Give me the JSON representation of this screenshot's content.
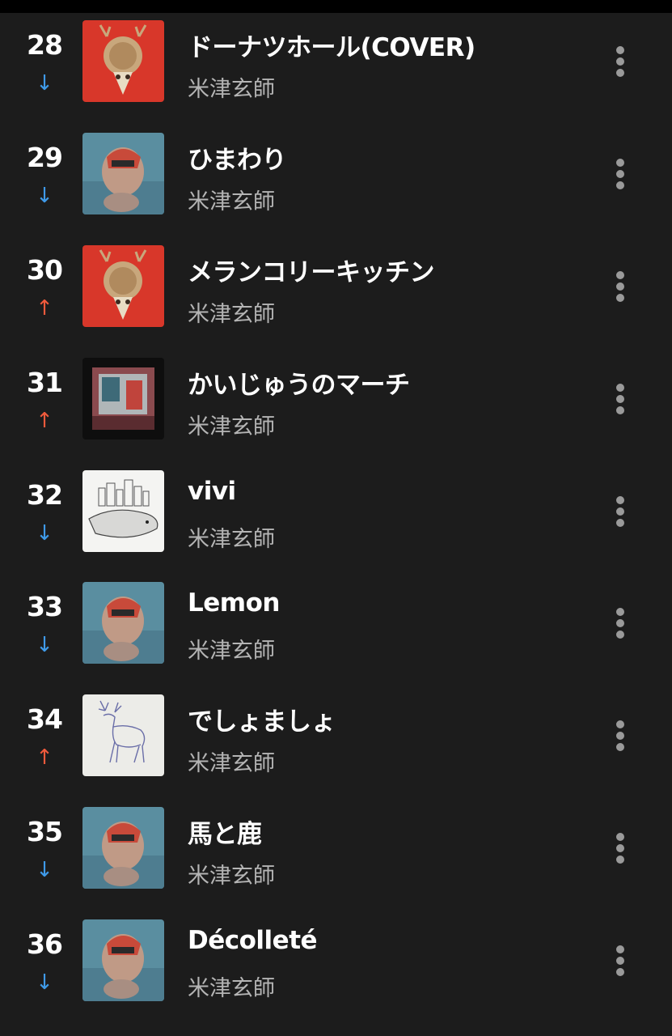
{
  "chart": {
    "rows": [
      {
        "rank": "28",
        "trend": "down",
        "trend_icon": "↓",
        "title": "ドーナツホール(COVER)",
        "artist": "米津玄師",
        "art": "yankee"
      },
      {
        "rank": "29",
        "trend": "down",
        "trend_icon": "↓",
        "title": "ひまわり",
        "artist": "米津玄師",
        "art": "stray-sheep"
      },
      {
        "rank": "30",
        "trend": "up",
        "trend_icon": "↑",
        "title": "メランコリーキッチン",
        "artist": "米津玄師",
        "art": "yankee"
      },
      {
        "rank": "31",
        "trend": "up",
        "trend_icon": "↑",
        "title": "かいじゅうのマーチ",
        "artist": "米津玄師",
        "art": "bootleg"
      },
      {
        "rank": "32",
        "trend": "down",
        "trend_icon": "↓",
        "title": "vivi",
        "artist": "米津玄師",
        "art": "diorama"
      },
      {
        "rank": "33",
        "trend": "down",
        "trend_icon": "↓",
        "title": "Lemon",
        "artist": "米津玄師",
        "art": "stray-sheep"
      },
      {
        "rank": "34",
        "trend": "up",
        "trend_icon": "↑",
        "title": "でしょましょ",
        "artist": "米津玄師",
        "art": "deer"
      },
      {
        "rank": "35",
        "trend": "down",
        "trend_icon": "↓",
        "title": "馬と鹿",
        "artist": "米津玄師",
        "art": "stray-sheep"
      },
      {
        "rank": "36",
        "trend": "down",
        "trend_icon": "↓",
        "title": "Décolleté",
        "artist": "米津玄師",
        "art": "stray-sheep"
      }
    ]
  },
  "colors": {
    "background": "#1c1c1c",
    "trend_up": "#ef5a3c",
    "trend_down": "#3f9ae8",
    "artist_text": "#b4b4b4"
  }
}
